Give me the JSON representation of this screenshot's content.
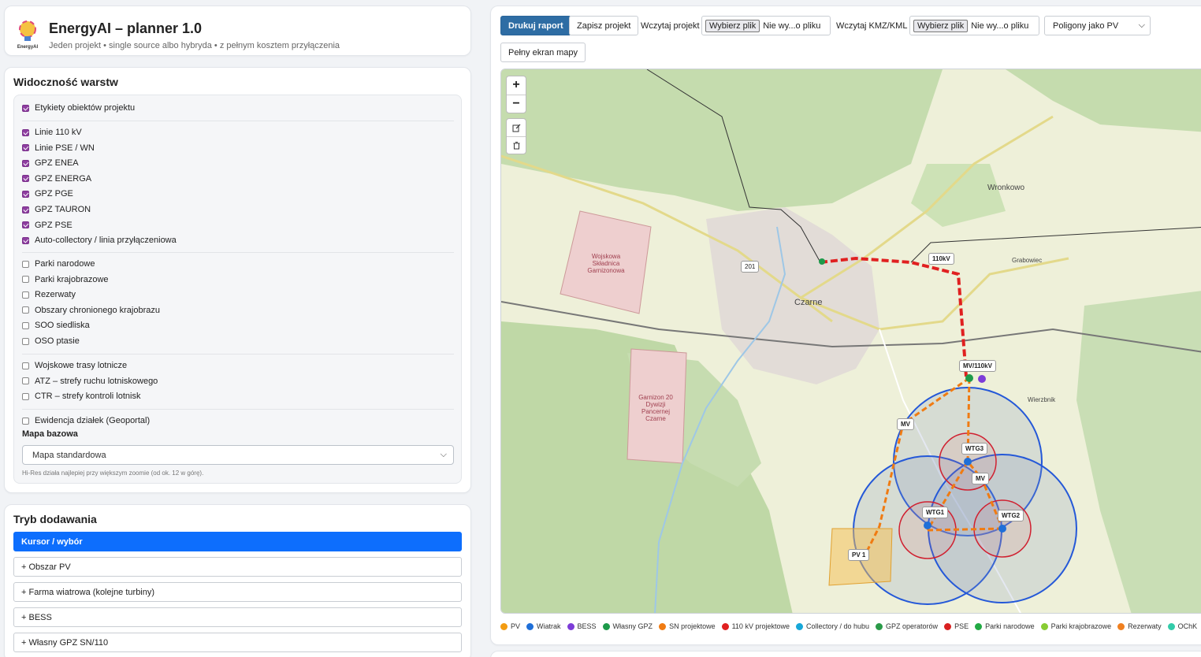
{
  "header": {
    "title": "EnergyAI – planner 1.0",
    "subtitle": "Jeden projekt • single source albo hybryda • z pełnym kosztem przyłączenia",
    "logo_text": "EnergyAI"
  },
  "layers": {
    "title": "Widoczność warstw",
    "groups": [
      [
        {
          "label": "Etykiety obiektów projektu",
          "checked": true
        }
      ],
      [
        {
          "label": "Linie 110 kV",
          "checked": true
        },
        {
          "label": "Linie PSE / WN",
          "checked": true
        },
        {
          "label": "GPZ ENEA",
          "checked": true
        },
        {
          "label": "GPZ ENERGA",
          "checked": true
        },
        {
          "label": "GPZ PGE",
          "checked": true
        },
        {
          "label": "GPZ TAURON",
          "checked": true
        },
        {
          "label": "GPZ PSE",
          "checked": true
        },
        {
          "label": "Auto-collectory / linia przyłączeniowa",
          "checked": true
        }
      ],
      [
        {
          "label": "Parki narodowe",
          "checked": false
        },
        {
          "label": "Parki krajobrazowe",
          "checked": false
        },
        {
          "label": "Rezerwaty",
          "checked": false
        },
        {
          "label": "Obszary chronionego krajobrazu",
          "checked": false
        },
        {
          "label": "SOO siedliska",
          "checked": false
        },
        {
          "label": "OSO ptasie",
          "checked": false
        }
      ],
      [
        {
          "label": "Wojskowe trasy lotnicze",
          "checked": false
        },
        {
          "label": "ATZ – strefy ruchu lotniskowego",
          "checked": false
        },
        {
          "label": "CTR – strefy kontroli lotnisk",
          "checked": false
        }
      ],
      [
        {
          "label": "Ewidencja działek (Geoportal)",
          "checked": false
        }
      ]
    ],
    "basemap_label": "Mapa bazowa",
    "basemap_value": "Mapa standardowa",
    "hint": "Hi-Res działa najlepiej przy większym zoomie (od ok. 12 w górę)."
  },
  "add_mode": {
    "title": "Tryb dodawania",
    "buttons": [
      {
        "label": "Kursor / wybór",
        "active": true
      },
      {
        "label": "+ Obszar PV",
        "active": false
      },
      {
        "label": "+ Farma wiatrowa (kolejne turbiny)",
        "active": false
      },
      {
        "label": "+ BESS",
        "active": false
      },
      {
        "label": "+ Własny GPZ SN/110",
        "active": false
      }
    ]
  },
  "toolbar": {
    "print_label": "Drukuj raport",
    "save_label": "Zapisz projekt",
    "load_project_label": "Wczytaj projekt",
    "load_kmz_label": "Wczytaj KMZ/KML",
    "file_button": "Wybierz plik",
    "file_status": "Nie wy...o pliku",
    "poly_select": "Poligony jako PV",
    "fullscreen_label": "Pełny ekran mapy"
  },
  "map": {
    "zoom_in": "+",
    "zoom_out": "−",
    "labels": {
      "line_110": "110kV",
      "gpz": "MV/110kV",
      "mv1": "MV",
      "mv2": "MV",
      "wtg1": "WTG1",
      "wtg2": "WTG2",
      "wtg3": "WTG3",
      "pv1": "PV 1"
    },
    "places": {
      "czarne": "Czarne",
      "wronkowo": "Wronkowo",
      "wierzbnik": "Wierzbnik",
      "grabowiec": "Grabowiec",
      "road": "201",
      "military1": "Wojskowa Składnica Garnizonowa",
      "military2": "Garnizon 20 Dywizji Pancernej Czarne"
    }
  },
  "legend": [
    {
      "label": "PV",
      "color": "#f39c12"
    },
    {
      "label": "Wiatrak",
      "color": "#1f6fd8"
    },
    {
      "label": "BESS",
      "color": "#7d3cd8"
    },
    {
      "label": "Własny GPZ",
      "color": "#1e9a4a"
    },
    {
      "label": "SN projektowe",
      "color": "#f07b12"
    },
    {
      "label": "110 kV projektowe",
      "color": "#e02020"
    },
    {
      "label": "Collectory / do hubu",
      "color": "#17a7d8"
    },
    {
      "label": "GPZ operatorów",
      "color": "#2a9a48"
    },
    {
      "label": "PSE",
      "color": "#d92020"
    },
    {
      "label": "Parki narodowe",
      "color": "#22aa44"
    },
    {
      "label": "Parki krajobrazowe",
      "color": "#88cc33"
    },
    {
      "label": "Rezerwaty",
      "color": "#f08020"
    },
    {
      "label": "OChK",
      "color": "#33ccaa"
    }
  ]
}
